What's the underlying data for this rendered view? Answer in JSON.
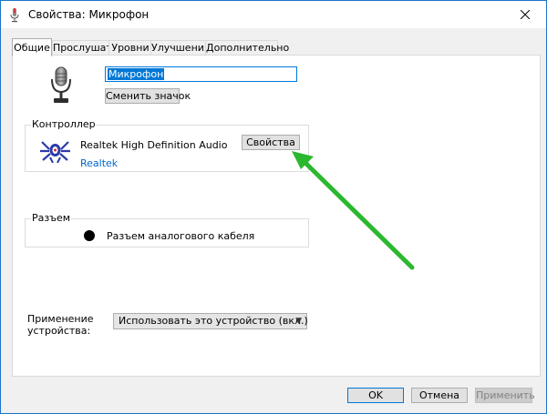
{
  "window": {
    "title": "Свойства: Микрофон"
  },
  "tabs": [
    {
      "label": "Общие"
    },
    {
      "label": "Прослушать"
    },
    {
      "label": "Уровни"
    },
    {
      "label": "Улучшения"
    },
    {
      "label": "Дополнительно"
    }
  ],
  "device": {
    "name": "Микрофон",
    "change_icon_label": "Сменить значок"
  },
  "controller": {
    "group_label": "Контроллер",
    "name": "Realtek High Definition Audio",
    "vendor_link": "Realtek",
    "properties_label": "Свойства"
  },
  "jack": {
    "group_label": "Разъем",
    "description": "Разъем аналогового кабеля"
  },
  "usage": {
    "label_line1": "Применение",
    "label_line2": "устройства:",
    "selected": "Использовать это устройство (вкл.)"
  },
  "buttons": {
    "ok": "OK",
    "cancel": "Отмена",
    "apply": "Применить"
  },
  "colors": {
    "accent": "#0078d7",
    "arrow": "#2bb82f",
    "link": "#0066cc"
  },
  "icons": {
    "title": "microphone-icon",
    "device": "microphone-icon",
    "controller": "realtek-logo-icon",
    "close": "close-icon",
    "dropdown": "chevron-down-icon",
    "annotation": "green-arrow"
  }
}
